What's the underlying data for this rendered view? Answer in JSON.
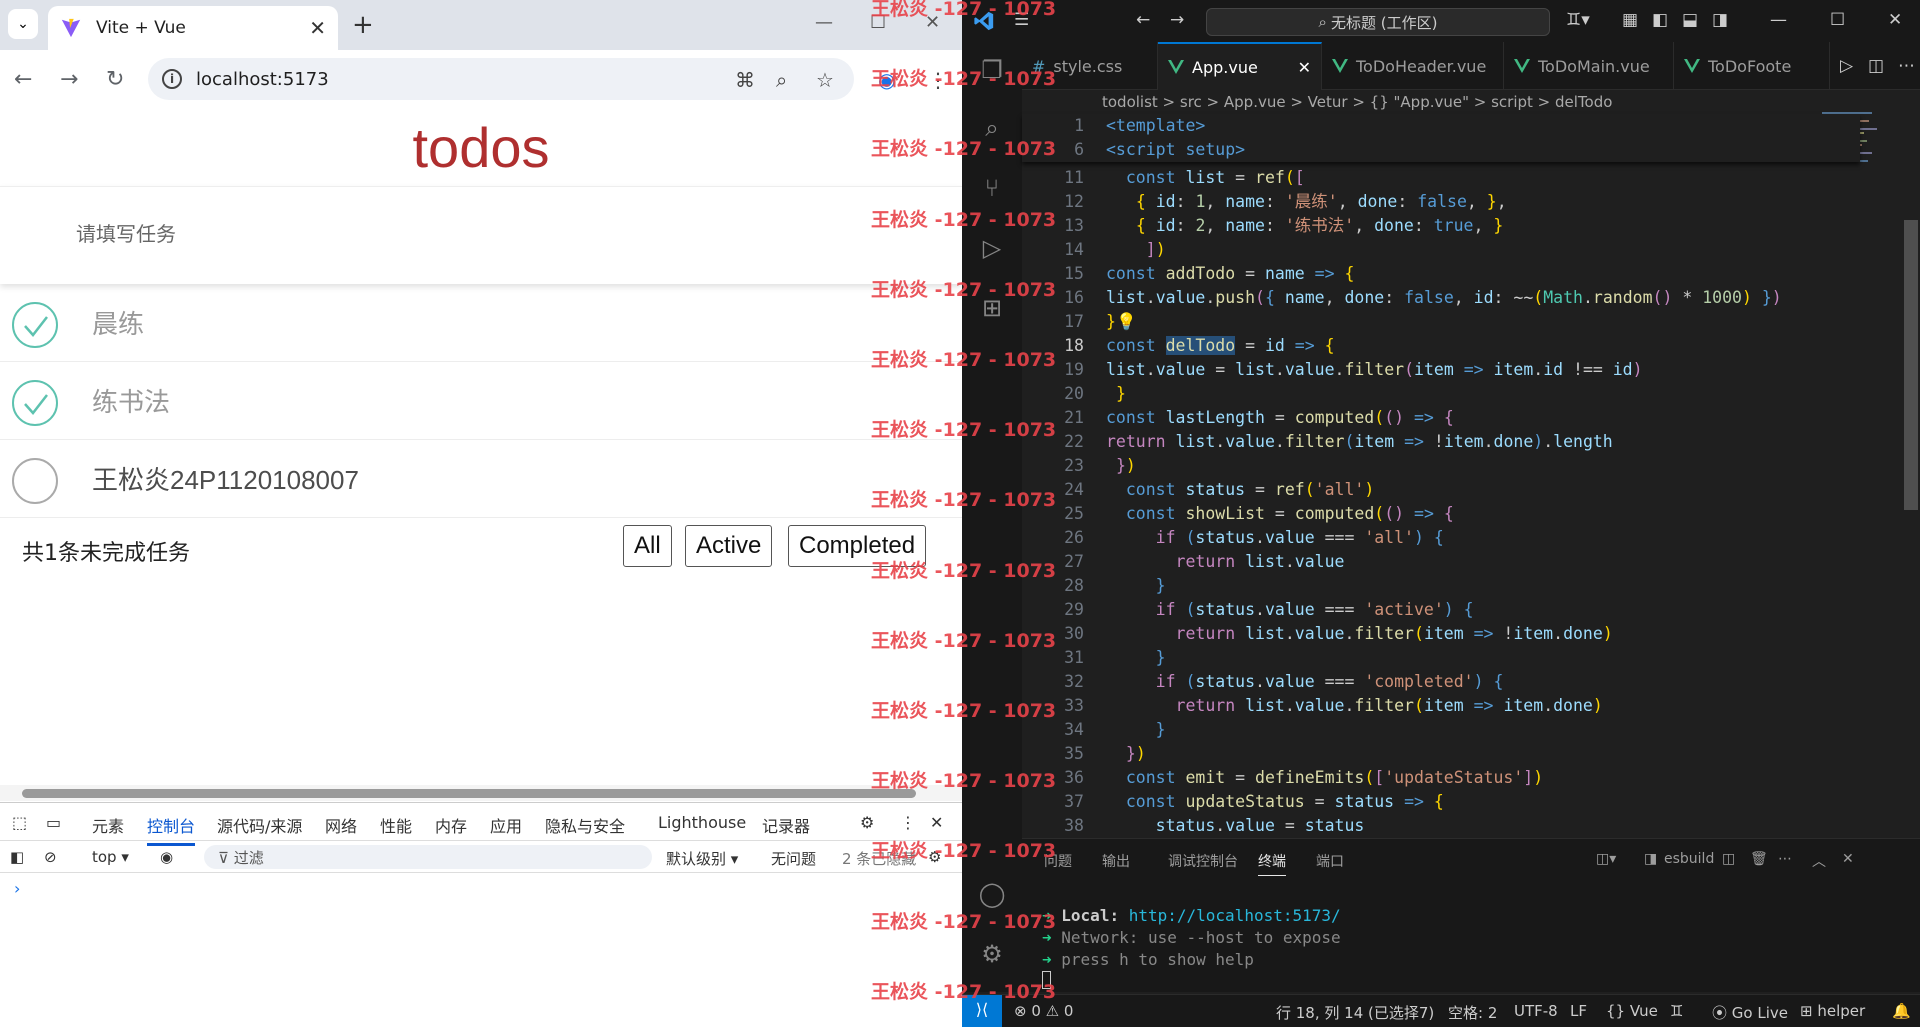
{
  "browser": {
    "tab_title": "Vite + Vue",
    "url": "localhost:5173"
  },
  "app": {
    "title": "todos",
    "input_placeholder": "请填写任务",
    "todos": [
      {
        "name": "晨练",
        "done": true
      },
      {
        "name": "练书法",
        "done": true
      },
      {
        "name": "王松炎24P1120108007",
        "done": false
      }
    ],
    "footer": {
      "count_text": "共1条未完成任务",
      "filters": [
        "All",
        "Active",
        "Completed"
      ]
    }
  },
  "devtools": {
    "tabs": [
      "元素",
      "控制台",
      "源代码/来源",
      "网络",
      "性能",
      "内存",
      "应用",
      "隐私与安全",
      "Lighthouse",
      "记录器"
    ],
    "active_tab": "控制台",
    "context": "top",
    "filter_placeholder": "过滤",
    "level": "默认级别",
    "issues": "无问题",
    "hidden": "2 条已隐藏"
  },
  "vscode": {
    "search": "无标题 (工作区)",
    "tabs": [
      {
        "label": "style.css",
        "active": false
      },
      {
        "label": "App.vue",
        "active": true
      },
      {
        "label": "ToDoHeader.vue",
        "active": false
      },
      {
        "label": "ToDoMain.vue",
        "active": false
      },
      {
        "label": "ToDoFoote",
        "active": false
      }
    ],
    "breadcrumbs": "todolist > src > App.vue > Vetur > {} \"App.vue\" > script > delTodo",
    "sticky_lines": [
      {
        "num": "1",
        "text": "<template>"
      },
      {
        "num": "6",
        "text": "<script setup>"
      }
    ],
    "line_numbers": [
      "11",
      "12",
      "13",
      "14",
      "15",
      "16",
      "17",
      "18",
      "19",
      "20",
      "21",
      "22",
      "23",
      "24",
      "25",
      "26",
      "27",
      "28",
      "29",
      "30",
      "31",
      "32",
      "33",
      "34",
      "35",
      "36",
      "37",
      "38"
    ],
    "panel_tabs": [
      "问题",
      "输出",
      "调试控制台",
      "终端",
      "端口"
    ],
    "active_panel": "终端",
    "terminal_shell": "esbuild",
    "terminal": {
      "local_label": "Local:",
      "local_url": "http://localhost:5173/",
      "network_label": "Network:",
      "network_text": "use --host to expose",
      "help_text": "press h to show help"
    },
    "status": {
      "errors": "0",
      "warnings": "0",
      "position": "行 18, 列 14 (已选择7)",
      "spaces": "空格: 2",
      "encoding": "UTF-8",
      "eol": "LF",
      "language": "Vue",
      "golive": "Go Live",
      "helper": "helper"
    }
  },
  "watermark": "王松炎 -127 - 1073",
  "colors": {
    "title_red": "#af2f2f",
    "check_green": "#5dc2af",
    "vscode_blue": "#0078d4",
    "watermark": "#e8434a"
  }
}
